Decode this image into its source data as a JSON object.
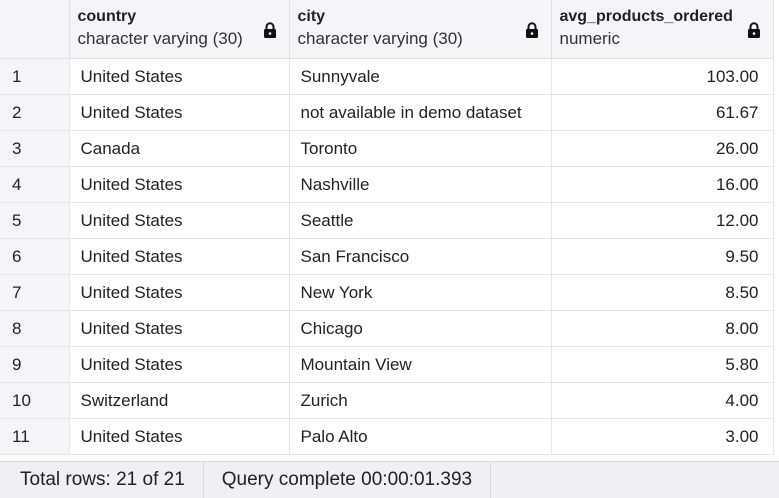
{
  "columns": [
    {
      "name": "country",
      "type": "character varying (30)",
      "locked": true
    },
    {
      "name": "city",
      "type": "character varying (30)",
      "locked": true
    },
    {
      "name": "avg_products_ordered",
      "type": "numeric",
      "locked": true
    }
  ],
  "rows": [
    {
      "n": "1",
      "country": "United States",
      "city": "Sunnyvale",
      "avg": "103.00"
    },
    {
      "n": "2",
      "country": "United States",
      "city": "not available in demo dataset",
      "avg": "61.67"
    },
    {
      "n": "3",
      "country": "Canada",
      "city": "Toronto",
      "avg": "26.00"
    },
    {
      "n": "4",
      "country": "United States",
      "city": "Nashville",
      "avg": "16.00"
    },
    {
      "n": "5",
      "country": "United States",
      "city": "Seattle",
      "avg": "12.00"
    },
    {
      "n": "6",
      "country": "United States",
      "city": "San Francisco",
      "avg": "9.50"
    },
    {
      "n": "7",
      "country": "United States",
      "city": "New York",
      "avg": "8.50"
    },
    {
      "n": "8",
      "country": "United States",
      "city": "Chicago",
      "avg": "8.00"
    },
    {
      "n": "9",
      "country": "United States",
      "city": "Mountain View",
      "avg": "5.80"
    },
    {
      "n": "10",
      "country": "Switzerland",
      "city": "Zurich",
      "avg": "4.00"
    },
    {
      "n": "11",
      "country": "United States",
      "city": "Palo Alto",
      "avg": "3.00"
    }
  ],
  "status": {
    "total_rows": "Total rows: 21 of 21",
    "query": "Query complete 00:00:01.393"
  },
  "icons": {
    "lock": "lock-icon"
  },
  "colors": {
    "header_bg": "#f3f5f9",
    "status_bg": "#eef0f4"
  }
}
